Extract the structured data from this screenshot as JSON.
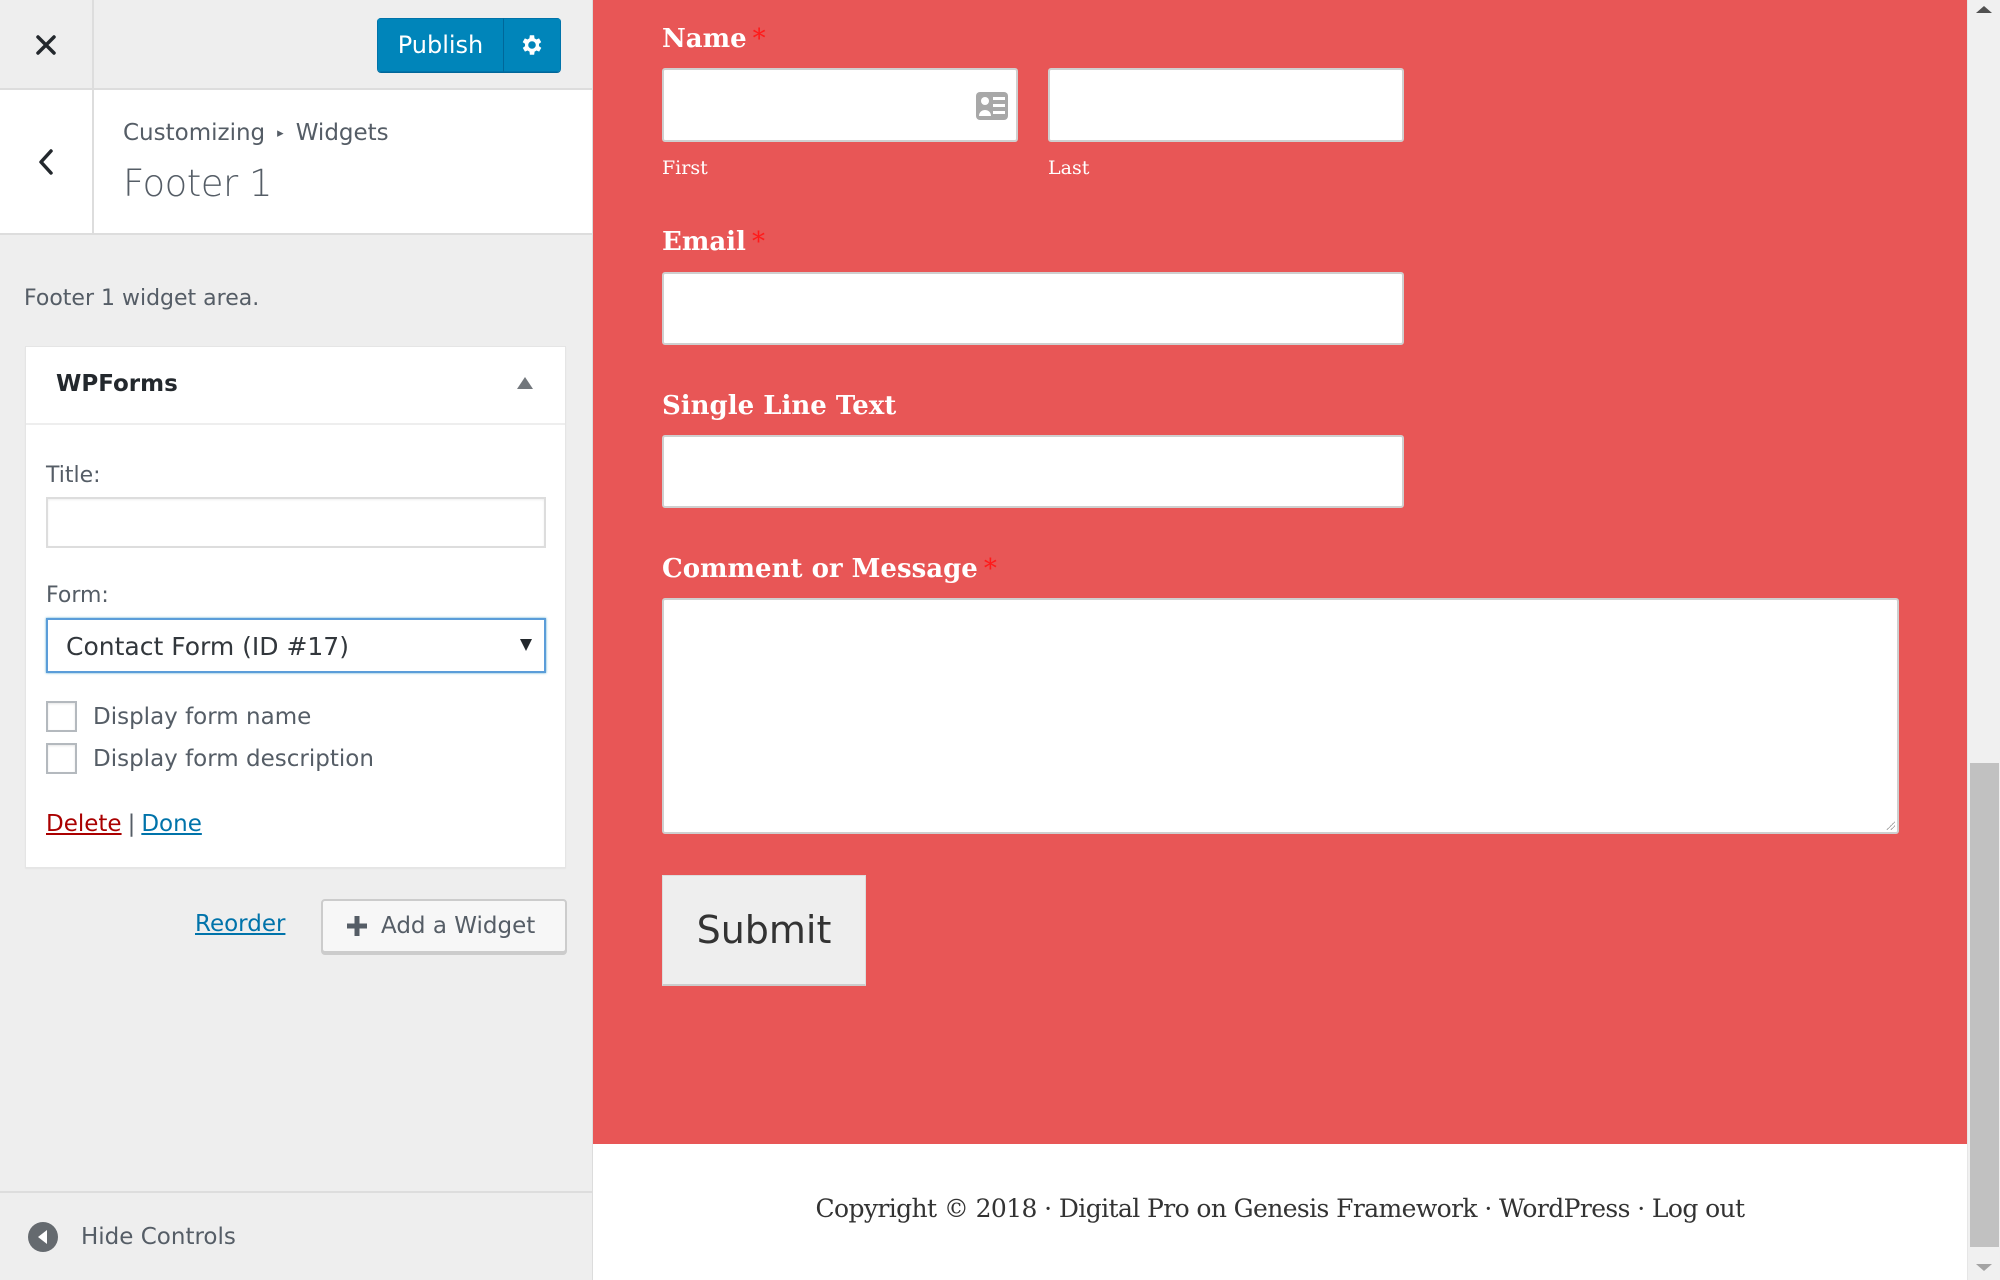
{
  "customizer": {
    "close_label": "Close",
    "publish_label": "Publish",
    "settings_label": "Publish Settings",
    "breadcrumb": [
      "Customizing",
      "Widgets"
    ],
    "section_title": "Footer 1",
    "area_description": "Footer 1 widget area.",
    "widget": {
      "title": "WPForms",
      "title_label": "Title:",
      "title_value": "",
      "form_label": "Form:",
      "form_selected": "Contact Form (ID #17)",
      "checkboxes": [
        {
          "label": "Display form name",
          "checked": false
        },
        {
          "label": "Display form description",
          "checked": false
        }
      ],
      "delete_label": "Delete",
      "separator": "|",
      "done_label": "Done"
    },
    "reorder_label": "Reorder",
    "add_widget_label": "Add a Widget",
    "hide_controls_label": "Hide Controls"
  },
  "preview": {
    "colors": {
      "section_bg": "#e85656",
      "required": "#ff1a1a"
    },
    "form": {
      "name_label": "Name",
      "name_first_label": "First",
      "name_last_label": "Last",
      "email_label": "Email",
      "single_line_label": "Single Line Text",
      "comment_label": "Comment or Message",
      "required_marker": "*",
      "submit_label": "Submit"
    },
    "footer_text": "Copyright © 2018 · Digital Pro on Genesis Framework · WordPress · Log out"
  }
}
